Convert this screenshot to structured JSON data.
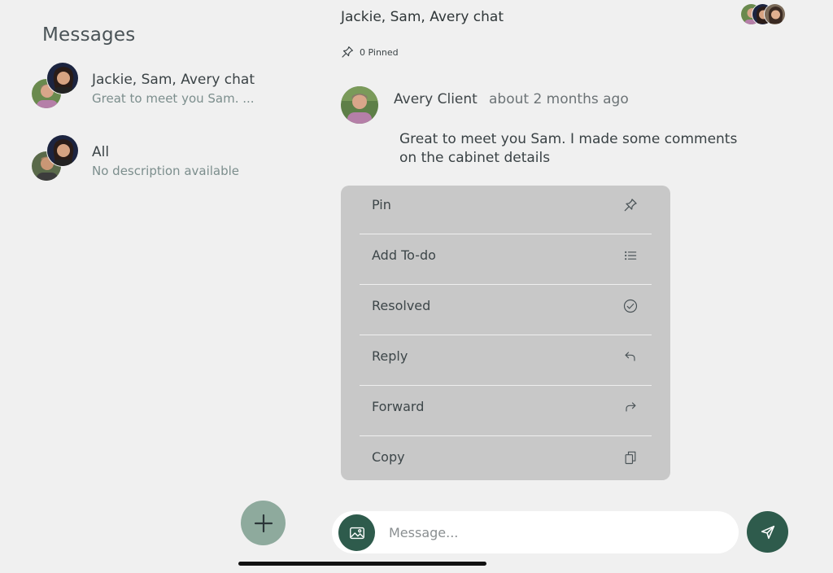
{
  "sidebar": {
    "title": "Messages",
    "conversations": [
      {
        "name": "Jackie, Sam, Avery chat",
        "preview": "Great to meet you Sam. ..."
      },
      {
        "name": "All",
        "preview": "No description available"
      }
    ]
  },
  "header": {
    "title": "Jackie, Sam, Avery chat",
    "pinned_label": "0 Pinned"
  },
  "message": {
    "author": "Avery Client",
    "time": "about 2 months ago",
    "text": "Great to meet you Sam. I made some comments on the cabinet details"
  },
  "context_menu": {
    "items": [
      {
        "label": "Pin",
        "icon": "pin-icon"
      },
      {
        "label": "Add To-do",
        "icon": "list-icon"
      },
      {
        "label": "Resolved",
        "icon": "check-circle-icon"
      },
      {
        "label": "Reply",
        "icon": "reply-icon"
      },
      {
        "label": "Forward",
        "icon": "forward-icon"
      },
      {
        "label": "Copy",
        "icon": "copy-icon"
      }
    ]
  },
  "composer": {
    "placeholder": "Message..."
  },
  "colors": {
    "background": "#f0f0f0",
    "accent": "#2e5b4c",
    "fab": "#8eaa9d",
    "menu_bg": "#c8c8c8"
  }
}
